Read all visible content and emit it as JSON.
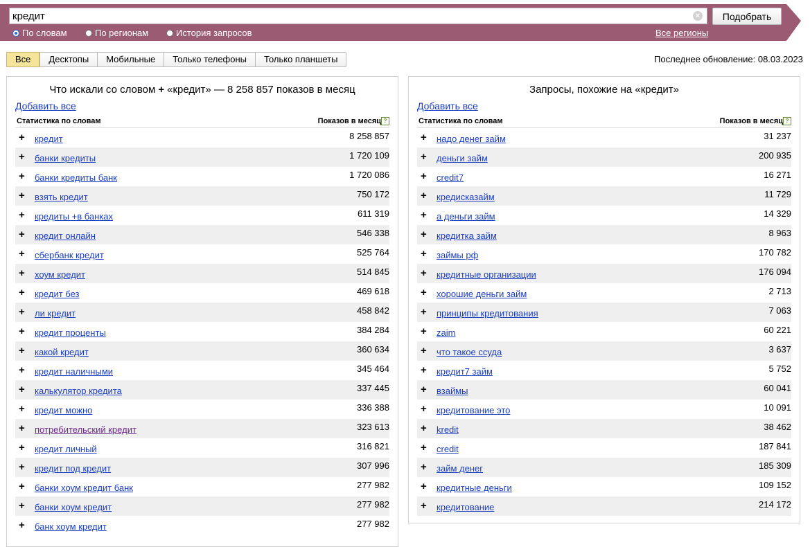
{
  "search": {
    "query": "кредит",
    "submit_label": "Подобрать"
  },
  "modes": [
    {
      "label": "По словам",
      "checked": true
    },
    {
      "label": "По регионам",
      "checked": false
    },
    {
      "label": "История запросов",
      "checked": false
    }
  ],
  "regions_label": "Все регионы",
  "tabs": [
    "Все",
    "Десктопы",
    "Мобильные",
    "Только телефоны",
    "Только планшеты"
  ],
  "last_update": "Последнее обновление: 08.03.2023",
  "colors": {
    "topbar": "#9b5b73",
    "link": "#1a3dc1",
    "active_tab": "#f5e59b"
  },
  "left": {
    "title_prefix": "Что искали со словом",
    "title_suffix": "«кредит» — 8 258 857 показов в месяц",
    "add_all": "Добавить все",
    "col1": "Статистика по словам",
    "col2": "Показов в месяц",
    "rows": [
      {
        "kw": "кредит",
        "cnt": "8 258 857"
      },
      {
        "kw": "банки кредиты",
        "cnt": "1 720 109"
      },
      {
        "kw": "банки кредиты банк",
        "cnt": "1 720 086"
      },
      {
        "kw": "взять кредит",
        "cnt": "750 172"
      },
      {
        "kw": "кредиты +в банках",
        "cnt": "611 319"
      },
      {
        "kw": "кредит онлайн",
        "cnt": "546 338"
      },
      {
        "kw": "сбербанк кредит",
        "cnt": "525 764"
      },
      {
        "kw": "хоум кредит",
        "cnt": "514 845"
      },
      {
        "kw": "кредит без",
        "cnt": "469 618"
      },
      {
        "kw": "ли кредит",
        "cnt": "458 842"
      },
      {
        "kw": "кредит проценты",
        "cnt": "384 284"
      },
      {
        "kw": "какой кредит",
        "cnt": "360 634"
      },
      {
        "kw": "кредит наличными",
        "cnt": "345 464"
      },
      {
        "kw": "калькулятор кредита",
        "cnt": "337 445"
      },
      {
        "kw": "кредит можно",
        "cnt": "336 388"
      },
      {
        "kw": "потребительский кредит",
        "cnt": "323 613",
        "visited": true
      },
      {
        "kw": "кредит личный",
        "cnt": "316 821"
      },
      {
        "kw": "кредит под кредит",
        "cnt": "307 996"
      },
      {
        "kw": "банки хоум кредит банк",
        "cnt": "277 982"
      },
      {
        "kw": "банки хоум кредит",
        "cnt": "277 982"
      },
      {
        "kw": "банк хоум кредит",
        "cnt": "277 982"
      }
    ]
  },
  "right": {
    "title": "Запросы, похожие на «кредит»",
    "add_all": "Добавить все",
    "col1": "Статистика по словам",
    "col2": "Показов в месяц",
    "rows": [
      {
        "kw": "надо денег займ",
        "cnt": "31 237"
      },
      {
        "kw": "деньги займ",
        "cnt": "200 935"
      },
      {
        "kw": "credit7",
        "cnt": "16 271"
      },
      {
        "kw": "кредисказайм",
        "cnt": "11 729"
      },
      {
        "kw": "а деньги займ",
        "cnt": "14 329"
      },
      {
        "kw": "кредитка займ",
        "cnt": "8 963"
      },
      {
        "kw": "займы рф",
        "cnt": "170 782"
      },
      {
        "kw": "кредитные организации",
        "cnt": "176 094"
      },
      {
        "kw": "хорошие деньги займ",
        "cnt": "2 713"
      },
      {
        "kw": "принципы кредитования",
        "cnt": "7 063"
      },
      {
        "kw": "zaim",
        "cnt": "60 221"
      },
      {
        "kw": "что такое ссуда",
        "cnt": "3 637"
      },
      {
        "kw": "кредит7 займ",
        "cnt": "5 752"
      },
      {
        "kw": "взаймы",
        "cnt": "60 041"
      },
      {
        "kw": "кредитование это",
        "cnt": "10 091"
      },
      {
        "kw": "kredit",
        "cnt": "38 462"
      },
      {
        "kw": "credit",
        "cnt": "187 841"
      },
      {
        "kw": "займ денег",
        "cnt": "185 309"
      },
      {
        "kw": "кредитные деньги",
        "cnt": "109 152"
      },
      {
        "kw": "кредитование",
        "cnt": "214 172"
      }
    ]
  }
}
